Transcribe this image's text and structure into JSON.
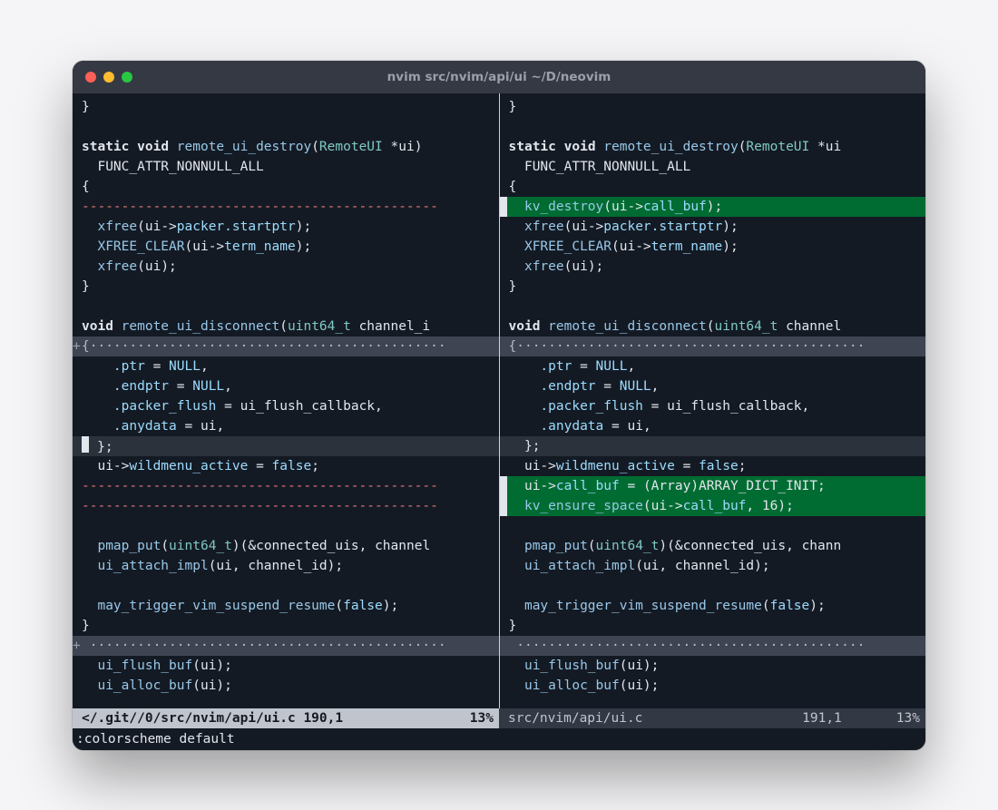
{
  "window": {
    "title": "nvim src/nvim/api/ui ~/D/neovim"
  },
  "left": {
    "lines": [
      {
        "text": "}"
      },
      {
        "text": ""
      },
      {
        "text": "static void remote_ui_destroy(RemoteUI *ui)",
        "syntax": [
          "kw:static",
          "kw:void",
          "fn:remote_ui_destroy",
          "type:RemoteUI",
          "id:*ui"
        ]
      },
      {
        "text": "  FUNC_ATTR_NONNULL_ALL"
      },
      {
        "text": "{"
      },
      {
        "class": "diffdel-dash",
        "text": "---------------------------------------------"
      },
      {
        "text": "  xfree(ui->packer.startptr);",
        "syntax": [
          "fn:xfree",
          "field:packer.startptr"
        ]
      },
      {
        "text": "  XFREE_CLEAR(ui->term_name);",
        "syntax": [
          "fn:XFREE_CLEAR",
          "field:term_name"
        ]
      },
      {
        "text": "  xfree(ui);",
        "syntax": [
          "fn:xfree"
        ]
      },
      {
        "text": "}"
      },
      {
        "text": ""
      },
      {
        "text": "void remote_ui_disconnect(uint64_t channel_i",
        "syntax": [
          "kw:void",
          "fn:remote_ui_disconnect",
          "type:uint64_t",
          "id:channel_i"
        ]
      },
      {
        "class": "folded",
        "fold": "+",
        "text": "{·············································"
      },
      {
        "text": "    .ptr = NULL,",
        "syntax": [
          "field:.ptr",
          "bool:NULL"
        ]
      },
      {
        "text": "    .endptr = NULL,",
        "syntax": [
          "field:.endptr",
          "bool:NULL"
        ]
      },
      {
        "text": "    .packer_flush = ui_flush_callback,",
        "syntax": [
          "field:.packer_flush",
          "id:ui_flush_callback"
        ]
      },
      {
        "text": "    .anydata = ui,",
        "syntax": [
          "field:.anydata",
          "id:ui"
        ]
      },
      {
        "class": "cursorline",
        "cursor": true,
        "text": "  };"
      },
      {
        "text": "  ui->wildmenu_active = false;",
        "syntax": [
          "field:wildmenu_active",
          "bool:false"
        ]
      },
      {
        "class": "diffdel-dash",
        "text": "---------------------------------------------"
      },
      {
        "class": "diffdel-dash",
        "text": "---------------------------------------------"
      },
      {
        "text": ""
      },
      {
        "text": "  pmap_put(uint64_t)(&connected_uis, channel",
        "syntax": [
          "fn:pmap_put",
          "type:uint64_t",
          "id:connected_uis",
          "id:channel"
        ]
      },
      {
        "text": "  ui_attach_impl(ui, channel_id);",
        "syntax": [
          "fn:ui_attach_impl",
          "id:channel_id"
        ]
      },
      {
        "text": ""
      },
      {
        "text": "  may_trigger_vim_suspend_resume(false);",
        "syntax": [
          "fn:may_trigger_vim_suspend_resume",
          "bool:false"
        ]
      },
      {
        "text": "}"
      },
      {
        "class": "folded",
        "fold": "+",
        "text": " ·············································"
      },
      {
        "text": "  ui_flush_buf(ui);",
        "syntax": [
          "fn:ui_flush_buf"
        ]
      },
      {
        "text": "  ui_alloc_buf(ui);",
        "syntax": [
          "fn:ui_alloc_buf"
        ]
      }
    ]
  },
  "right": {
    "lines": [
      {
        "text": "}"
      },
      {
        "text": ""
      },
      {
        "text": "static void remote_ui_destroy(RemoteUI *ui",
        "syntax": [
          "kw:static",
          "kw:void",
          "fn:remote_ui_destroy",
          "type:RemoteUI",
          "id:*ui"
        ]
      },
      {
        "text": "  FUNC_ATTR_NONNULL_ALL"
      },
      {
        "text": "{"
      },
      {
        "class": "diffadd",
        "sign": true,
        "text": "  kv_destroy(ui->call_buf);",
        "syntax": [
          "fn:kv_destroy",
          "field:call_buf"
        ]
      },
      {
        "text": "  xfree(ui->packer.startptr);",
        "syntax": [
          "fn:xfree",
          "field:packer.startptr"
        ]
      },
      {
        "text": "  XFREE_CLEAR(ui->term_name);",
        "syntax": [
          "fn:XFREE_CLEAR",
          "field:term_name"
        ]
      },
      {
        "text": "  xfree(ui);",
        "syntax": [
          "fn:xfree"
        ]
      },
      {
        "text": "}"
      },
      {
        "text": ""
      },
      {
        "text": "void remote_ui_disconnect(uint64_t channel",
        "syntax": [
          "kw:void",
          "fn:remote_ui_disconnect",
          "type:uint64_t",
          "id:channel"
        ]
      },
      {
        "class": "folded",
        "text": "{············································"
      },
      {
        "text": "    .ptr = NULL,",
        "syntax": [
          "field:.ptr",
          "bool:NULL"
        ]
      },
      {
        "text": "    .endptr = NULL,",
        "syntax": [
          "field:.endptr",
          "bool:NULL"
        ]
      },
      {
        "text": "    .packer_flush = ui_flush_callback,",
        "syntax": [
          "field:.packer_flush",
          "id:ui_flush_callback"
        ]
      },
      {
        "text": "    .anydata = ui,",
        "syntax": [
          "field:.anydata",
          "id:ui"
        ]
      },
      {
        "class": "cursorline",
        "text": "  };"
      },
      {
        "text": "  ui->wildmenu_active = false;",
        "syntax": [
          "field:wildmenu_active",
          "bool:false"
        ]
      },
      {
        "class": "diffadd",
        "sign": true,
        "text": "  ui->call_buf = (Array)ARRAY_DICT_INIT;",
        "syntax": [
          "field:call_buf",
          "cast:(Array)",
          "macro:ARRAY_DICT_INIT"
        ]
      },
      {
        "class": "diffadd",
        "sign": true,
        "text": "  kv_ensure_space(ui->call_buf, 16);",
        "syntax": [
          "fn:kv_ensure_space",
          "field:call_buf",
          "num:16"
        ]
      },
      {
        "text": ""
      },
      {
        "text": "  pmap_put(uint64_t)(&connected_uis, chann",
        "syntax": [
          "fn:pmap_put",
          "type:uint64_t",
          "id:connected_uis",
          "id:chann"
        ]
      },
      {
        "text": "  ui_attach_impl(ui, channel_id);",
        "syntax": [
          "fn:ui_attach_impl",
          "id:channel_id"
        ]
      },
      {
        "text": ""
      },
      {
        "text": "  may_trigger_vim_suspend_resume(false);",
        "syntax": [
          "fn:may_trigger_vim_suspend_resume",
          "bool:false"
        ]
      },
      {
        "text": "}"
      },
      {
        "class": "folded",
        "text": " ············································"
      },
      {
        "text": "  ui_flush_buf(ui);",
        "syntax": [
          "fn:ui_flush_buf"
        ]
      },
      {
        "text": "  ui_alloc_buf(ui);",
        "syntax": [
          "fn:ui_alloc_buf"
        ]
      }
    ]
  },
  "status": {
    "left": {
      "path": "</.git//0/src/nvim/api/ui.c",
      "pos": "190,1",
      "pct": "13%"
    },
    "right": {
      "path": "src/nvim/api/ui.c",
      "pos": "191,1",
      "pct": "13%"
    }
  },
  "cmdline": ":colorscheme default"
}
